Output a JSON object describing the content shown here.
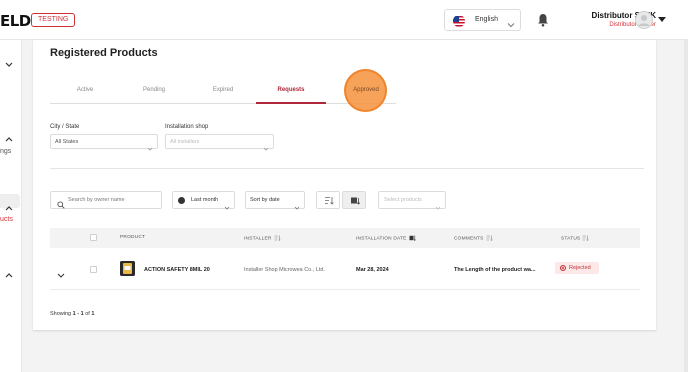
{
  "header": {
    "logo_text": "ELD",
    "env_badge": "TESTING",
    "language": "English",
    "user_name": "Distributor STEK",
    "user_role": "Distributor Owner"
  },
  "sidebar": {
    "fragments": [
      "ngs",
      "ucts"
    ]
  },
  "page": {
    "title": "Registered Products",
    "tabs": [
      {
        "label": "Active",
        "active": false
      },
      {
        "label": "Pending",
        "active": false
      },
      {
        "label": "Expired",
        "active": false
      },
      {
        "label": "Requests",
        "active": true
      },
      {
        "label": "Approved",
        "active": false
      }
    ]
  },
  "filters": {
    "city_label": "City / State",
    "city_value": "All States",
    "installer_label": "Installation shop",
    "installer_placeholder": "All installers",
    "search_placeholder": "Search by owner name",
    "period_value": "Last month",
    "sort_value": "Sort by date",
    "products_placeholder": "Select products"
  },
  "table": {
    "headers": {
      "product": "PRODUCT",
      "installer": "INSTALLER",
      "date": "INSTALLATION DATE",
      "comments": "COMMENTS",
      "status": "STATUS"
    },
    "rows": [
      {
        "product": "ACTION SAFETY 8MIL 20",
        "installer": "Installer Shop Microwea Co., Ltd.",
        "date": "Mar 28, 2024",
        "comments": "The Length of the product wa...",
        "status": "Rejected"
      }
    ]
  },
  "footer": {
    "showing_prefix": "Showing",
    "range_start": "1",
    "range_sep": "-",
    "range_end": "1",
    "of": "of",
    "total": "1"
  },
  "colors": {
    "accent": "#b0283a",
    "status_rejected_bg": "#fde8e8",
    "status_rejected_fg": "#c0323a",
    "click_marker": "#f6923c"
  }
}
